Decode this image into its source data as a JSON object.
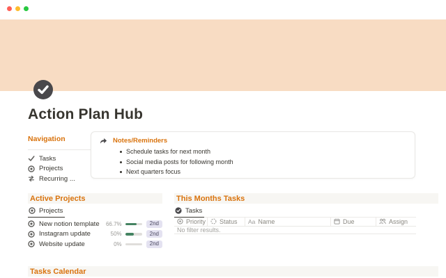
{
  "page": {
    "title": "Action Plan Hub"
  },
  "navigation": {
    "header": "Navigation",
    "items": [
      {
        "icon": "checkmark-icon",
        "label": "Tasks"
      },
      {
        "icon": "target-icon",
        "label": "Projects"
      },
      {
        "icon": "recurring-arrows-icon",
        "label": "Recurring ..."
      }
    ]
  },
  "callout": {
    "icon": "forward-arrow-icon",
    "title": "Notes/Reminders",
    "bullets": [
      "Schedule tasks for next month",
      "Social media posts for following month",
      "Next quarters focus"
    ]
  },
  "active_projects": {
    "header": "Active Projects",
    "tab": "Projects",
    "rows": [
      {
        "name": "New notion template",
        "percent": "66.7%",
        "progress": 66.7,
        "badge": "2nd"
      },
      {
        "name": "Instagram update",
        "percent": "50%",
        "progress": 50,
        "badge": "2nd"
      },
      {
        "name": "Website update",
        "percent": "0%",
        "progress": 0,
        "badge": "2nd"
      }
    ]
  },
  "monthly_tasks": {
    "header": "This Months Tasks",
    "tab": "Tasks",
    "columns": [
      {
        "icon": "priority-icon",
        "label": "Priority"
      },
      {
        "icon": "status-icon",
        "label": "Status"
      },
      {
        "icon": "text-icon",
        "icon_text": "Aa",
        "label": "Name"
      },
      {
        "icon": "calendar-icon",
        "label": "Due"
      },
      {
        "icon": "assign-people-icon",
        "label": "Assign"
      }
    ],
    "empty_text": "No filter results."
  },
  "tasks_calendar": {
    "header": "Tasks Calendar"
  },
  "colors": {
    "accent_orange": "#d9730d",
    "cover_peach": "#f8dcc3",
    "text_dark": "#37352f",
    "progress_green": "#448361",
    "badge_lavender": "#e4e2f1",
    "band_gray": "#f7f6f3",
    "traffic_red": "#ff5f57",
    "traffic_yellow": "#febc2e",
    "traffic_green": "#28c840"
  }
}
